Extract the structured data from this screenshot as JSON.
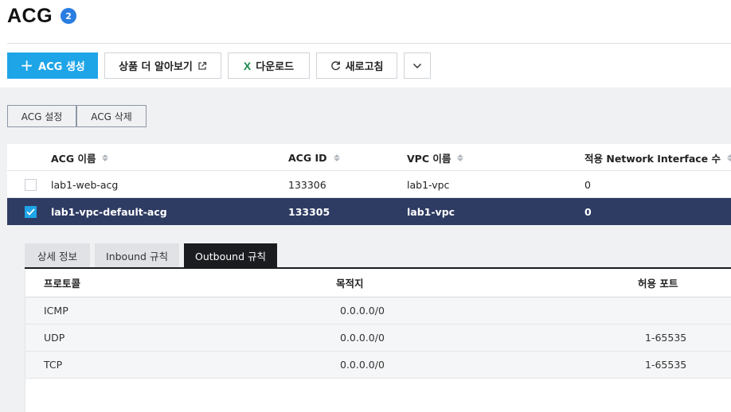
{
  "header": {
    "title": "ACG",
    "count": "2"
  },
  "toolbar": {
    "create_label": "ACG 생성",
    "learn_more_label": "상품 더 알아보기",
    "download_label": "다운로드",
    "refresh_label": "새로고침"
  },
  "actions": {
    "settings_label": "ACG 설정",
    "delete_label": "ACG 삭제"
  },
  "table": {
    "columns": {
      "name": "ACG 이름",
      "id": "ACG ID",
      "vpc": "VPC 이름",
      "ni_count": "적용 Network Interface 수"
    },
    "rows": [
      {
        "name": "lab1-web-acg",
        "id": "133306",
        "vpc": "lab1-vpc",
        "ni_count": "0",
        "selected": false
      },
      {
        "name": "lab1-vpc-default-acg",
        "id": "133305",
        "vpc": "lab1-vpc",
        "ni_count": "0",
        "selected": true
      }
    ]
  },
  "detail": {
    "tabs": [
      "상세 정보",
      "Inbound 규칙",
      "Outbound 규칙"
    ],
    "active_tab": "Outbound 규칙",
    "columns": {
      "protocol": "프로토콜",
      "destination": "목적지",
      "port": "허용 포트"
    },
    "rules": [
      {
        "protocol": "ICMP",
        "destination": "0.0.0.0/0",
        "port": ""
      },
      {
        "protocol": "UDP",
        "destination": "0.0.0.0/0",
        "port": "1-65535"
      },
      {
        "protocol": "TCP",
        "destination": "0.0.0.0/0",
        "port": "1-65535"
      }
    ]
  },
  "colors": {
    "primary": "#1ea5e8",
    "badge": "#2a7de1",
    "selected_row": "#2e3b63",
    "active_tab": "#1b1c1f",
    "excel": "#1f8a4c"
  }
}
